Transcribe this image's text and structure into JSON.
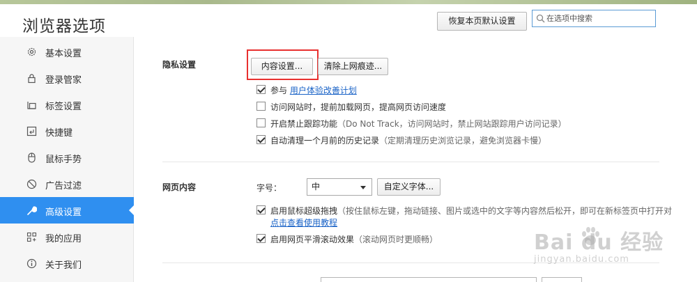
{
  "header": {
    "title": "浏览器选项",
    "restore_label": "恢复本页默认设置",
    "search_placeholder": "在选项中搜索"
  },
  "sidebar": {
    "items": [
      {
        "label": "基本设置",
        "icon": "gear-icon"
      },
      {
        "label": "登录管家",
        "icon": "lock-icon"
      },
      {
        "label": "标签设置",
        "icon": "tabs-icon"
      },
      {
        "label": "快捷键",
        "icon": "keyboard-icon"
      },
      {
        "label": "鼠标手势",
        "icon": "mouse-icon"
      },
      {
        "label": "广告过滤",
        "icon": "block-icon"
      },
      {
        "label": "高级设置",
        "icon": "wrench-icon",
        "active": true
      },
      {
        "label": "我的应用",
        "icon": "apps-icon"
      },
      {
        "label": "关于我们",
        "icon": "info-icon"
      }
    ]
  },
  "privacy": {
    "title": "隐私设置",
    "content_settings_label": "内容设置...",
    "clear_traces_label": "清除上网痕迹...",
    "options": [
      {
        "checked": true,
        "text": "参与 ",
        "link": "用户体验改善计划"
      },
      {
        "checked": false,
        "text": "访问网站时，提前加载网页，提高网页访问速度"
      },
      {
        "checked": false,
        "text": "开启禁止跟踪功能",
        "sub": "（Do Not Track，访问网站时，禁止网站跟踪用户访问记录）"
      },
      {
        "checked": true,
        "text": "自动清理一个月前的历史记录",
        "sub": "（定期清理历史浏览记录，避免浏览器卡慢）"
      }
    ]
  },
  "webcontent": {
    "title": "网页内容",
    "font_size_label": "字号：",
    "font_size_value": "中",
    "custom_font_label": "自定义字体...",
    "options": [
      {
        "checked": true,
        "text": "启用鼠标超级拖拽",
        "sub": "（按住鼠标左键，拖动链接、图片或选中的文字等内容然后松开，即可在新标签页中打开对",
        "link": "点击查看使用教程"
      },
      {
        "checked": true,
        "text": "启用网页平滑滚动效果",
        "sub": "（滚动网页时更顺畅）"
      }
    ]
  },
  "watermark": {
    "main": "Bai du 经验",
    "sub": "jingyan.baidu.com"
  },
  "colors": {
    "accent": "#2f8ff0",
    "highlight": "#e8302f",
    "link": "#1a63c7"
  }
}
